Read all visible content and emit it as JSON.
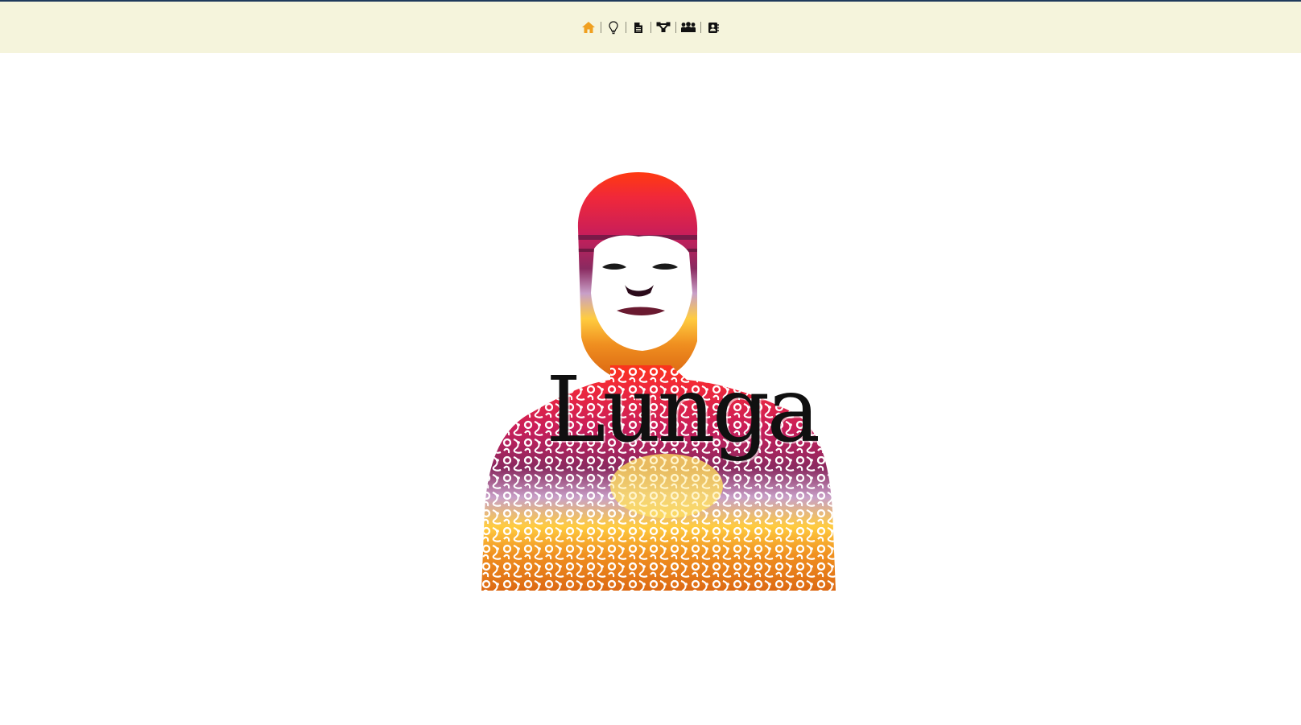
{
  "colors": {
    "top_line": "#1f3a5c",
    "nav_background": "#f5f4dc",
    "nav_active": "#f0a020",
    "nav_icon": "#111111"
  },
  "nav": {
    "items": [
      {
        "icon": "home-icon",
        "active": true
      },
      {
        "icon": "lightbulb-icon",
        "active": false
      },
      {
        "icon": "document-icon",
        "active": false
      },
      {
        "icon": "share-network-icon",
        "active": false
      },
      {
        "icon": "group-icon",
        "active": false
      },
      {
        "icon": "contact-card-icon",
        "active": false
      }
    ]
  },
  "hero": {
    "name": "Lunga"
  }
}
